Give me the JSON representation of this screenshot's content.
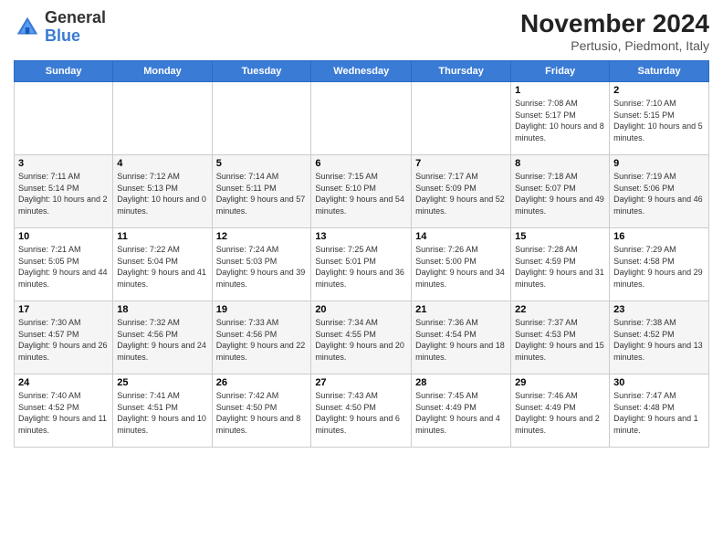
{
  "logo": {
    "general": "General",
    "blue": "Blue"
  },
  "header": {
    "month": "November 2024",
    "location": "Pertusio, Piedmont, Italy"
  },
  "days_of_week": [
    "Sunday",
    "Monday",
    "Tuesday",
    "Wednesday",
    "Thursday",
    "Friday",
    "Saturday"
  ],
  "weeks": [
    [
      {
        "day": "",
        "info": ""
      },
      {
        "day": "",
        "info": ""
      },
      {
        "day": "",
        "info": ""
      },
      {
        "day": "",
        "info": ""
      },
      {
        "day": "",
        "info": ""
      },
      {
        "day": "1",
        "info": "Sunrise: 7:08 AM\nSunset: 5:17 PM\nDaylight: 10 hours and 8 minutes."
      },
      {
        "day": "2",
        "info": "Sunrise: 7:10 AM\nSunset: 5:15 PM\nDaylight: 10 hours and 5 minutes."
      }
    ],
    [
      {
        "day": "3",
        "info": "Sunrise: 7:11 AM\nSunset: 5:14 PM\nDaylight: 10 hours and 2 minutes."
      },
      {
        "day": "4",
        "info": "Sunrise: 7:12 AM\nSunset: 5:13 PM\nDaylight: 10 hours and 0 minutes."
      },
      {
        "day": "5",
        "info": "Sunrise: 7:14 AM\nSunset: 5:11 PM\nDaylight: 9 hours and 57 minutes."
      },
      {
        "day": "6",
        "info": "Sunrise: 7:15 AM\nSunset: 5:10 PM\nDaylight: 9 hours and 54 minutes."
      },
      {
        "day": "7",
        "info": "Sunrise: 7:17 AM\nSunset: 5:09 PM\nDaylight: 9 hours and 52 minutes."
      },
      {
        "day": "8",
        "info": "Sunrise: 7:18 AM\nSunset: 5:07 PM\nDaylight: 9 hours and 49 minutes."
      },
      {
        "day": "9",
        "info": "Sunrise: 7:19 AM\nSunset: 5:06 PM\nDaylight: 9 hours and 46 minutes."
      }
    ],
    [
      {
        "day": "10",
        "info": "Sunrise: 7:21 AM\nSunset: 5:05 PM\nDaylight: 9 hours and 44 minutes."
      },
      {
        "day": "11",
        "info": "Sunrise: 7:22 AM\nSunset: 5:04 PM\nDaylight: 9 hours and 41 minutes."
      },
      {
        "day": "12",
        "info": "Sunrise: 7:24 AM\nSunset: 5:03 PM\nDaylight: 9 hours and 39 minutes."
      },
      {
        "day": "13",
        "info": "Sunrise: 7:25 AM\nSunset: 5:01 PM\nDaylight: 9 hours and 36 minutes."
      },
      {
        "day": "14",
        "info": "Sunrise: 7:26 AM\nSunset: 5:00 PM\nDaylight: 9 hours and 34 minutes."
      },
      {
        "day": "15",
        "info": "Sunrise: 7:28 AM\nSunset: 4:59 PM\nDaylight: 9 hours and 31 minutes."
      },
      {
        "day": "16",
        "info": "Sunrise: 7:29 AM\nSunset: 4:58 PM\nDaylight: 9 hours and 29 minutes."
      }
    ],
    [
      {
        "day": "17",
        "info": "Sunrise: 7:30 AM\nSunset: 4:57 PM\nDaylight: 9 hours and 26 minutes."
      },
      {
        "day": "18",
        "info": "Sunrise: 7:32 AM\nSunset: 4:56 PM\nDaylight: 9 hours and 24 minutes."
      },
      {
        "day": "19",
        "info": "Sunrise: 7:33 AM\nSunset: 4:56 PM\nDaylight: 9 hours and 22 minutes."
      },
      {
        "day": "20",
        "info": "Sunrise: 7:34 AM\nSunset: 4:55 PM\nDaylight: 9 hours and 20 minutes."
      },
      {
        "day": "21",
        "info": "Sunrise: 7:36 AM\nSunset: 4:54 PM\nDaylight: 9 hours and 18 minutes."
      },
      {
        "day": "22",
        "info": "Sunrise: 7:37 AM\nSunset: 4:53 PM\nDaylight: 9 hours and 15 minutes."
      },
      {
        "day": "23",
        "info": "Sunrise: 7:38 AM\nSunset: 4:52 PM\nDaylight: 9 hours and 13 minutes."
      }
    ],
    [
      {
        "day": "24",
        "info": "Sunrise: 7:40 AM\nSunset: 4:52 PM\nDaylight: 9 hours and 11 minutes."
      },
      {
        "day": "25",
        "info": "Sunrise: 7:41 AM\nSunset: 4:51 PM\nDaylight: 9 hours and 10 minutes."
      },
      {
        "day": "26",
        "info": "Sunrise: 7:42 AM\nSunset: 4:50 PM\nDaylight: 9 hours and 8 minutes."
      },
      {
        "day": "27",
        "info": "Sunrise: 7:43 AM\nSunset: 4:50 PM\nDaylight: 9 hours and 6 minutes."
      },
      {
        "day": "28",
        "info": "Sunrise: 7:45 AM\nSunset: 4:49 PM\nDaylight: 9 hours and 4 minutes."
      },
      {
        "day": "29",
        "info": "Sunrise: 7:46 AM\nSunset: 4:49 PM\nDaylight: 9 hours and 2 minutes."
      },
      {
        "day": "30",
        "info": "Sunrise: 7:47 AM\nSunset: 4:48 PM\nDaylight: 9 hours and 1 minute."
      }
    ]
  ]
}
